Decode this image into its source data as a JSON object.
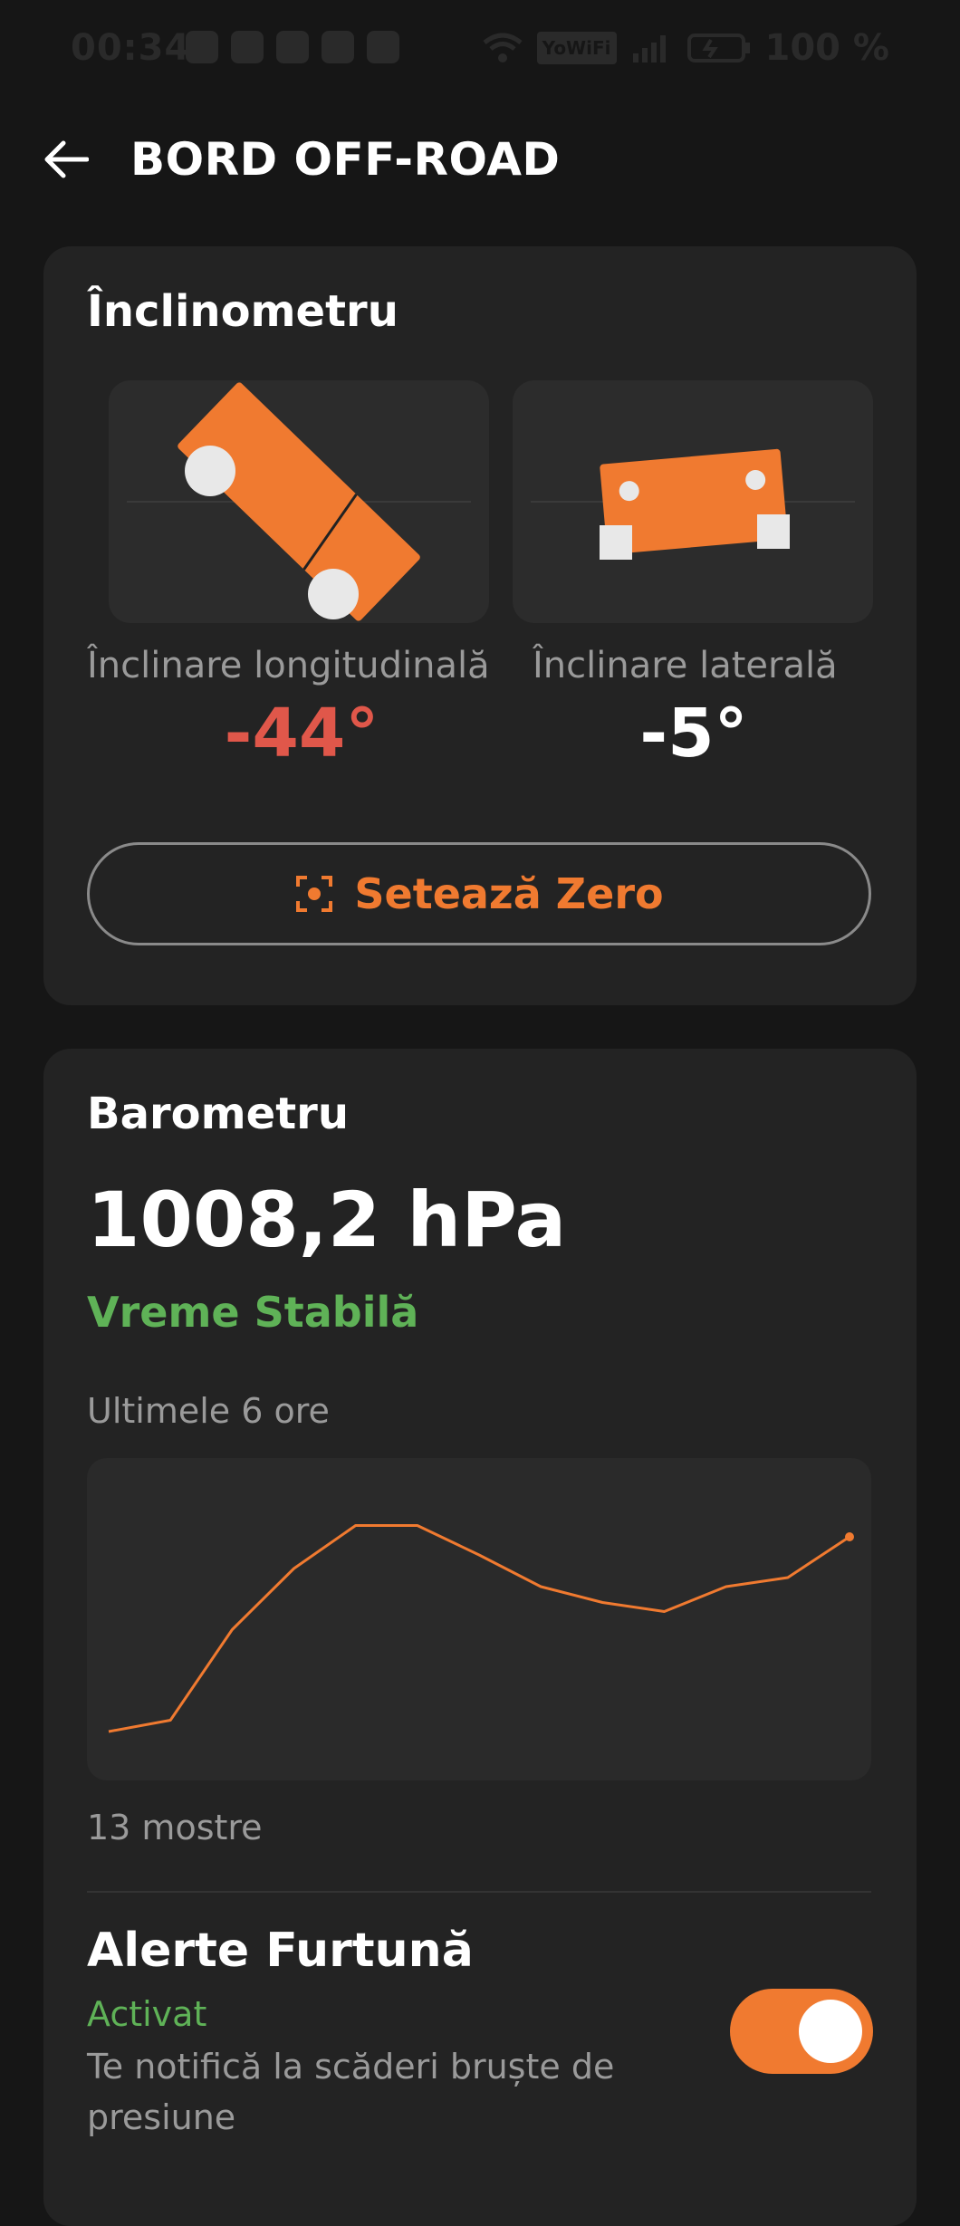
{
  "status_bar": {
    "time": "00:34",
    "network_label": "YoWiFi",
    "battery": "100 %"
  },
  "header": {
    "title": "BORD OFF-ROAD"
  },
  "inclinometer": {
    "title": "Înclinometru",
    "pitch_label": "Înclinare longitudinală",
    "pitch_value": "-44°",
    "pitch_degrees": -44,
    "roll_label": "Înclinare laterală",
    "roll_value": "-5°",
    "roll_degrees": -5,
    "zero_button_label": "Setează Zero"
  },
  "barometer": {
    "title": "Barometru",
    "pressure": "1008,2 hPa",
    "status": "Vreme Stabilă",
    "period": "Ultimele 6 ore",
    "samples": "13 mostre"
  },
  "chart_data": {
    "type": "line",
    "title": "",
    "xlabel": "",
    "ylabel": "",
    "x": [
      1,
      2,
      3,
      4,
      5,
      6,
      7,
      8,
      9,
      10,
      11,
      12,
      13
    ],
    "series": [
      {
        "values": [
          0.0,
          0.05,
          0.45,
          0.72,
          0.91,
          0.91,
          0.78,
          0.64,
          0.57,
          0.53,
          0.64,
          0.68,
          0.86
        ]
      }
    ],
    "color": "#f07a30"
  },
  "storm_alerts": {
    "title": "Alerte Furtună",
    "status": "Activat",
    "description": "Te notifică la scăderi bruște de presiune",
    "enabled": true
  },
  "colors": {
    "accent": "#f07a30",
    "danger": "#e0574a",
    "success": "#5fb257"
  }
}
